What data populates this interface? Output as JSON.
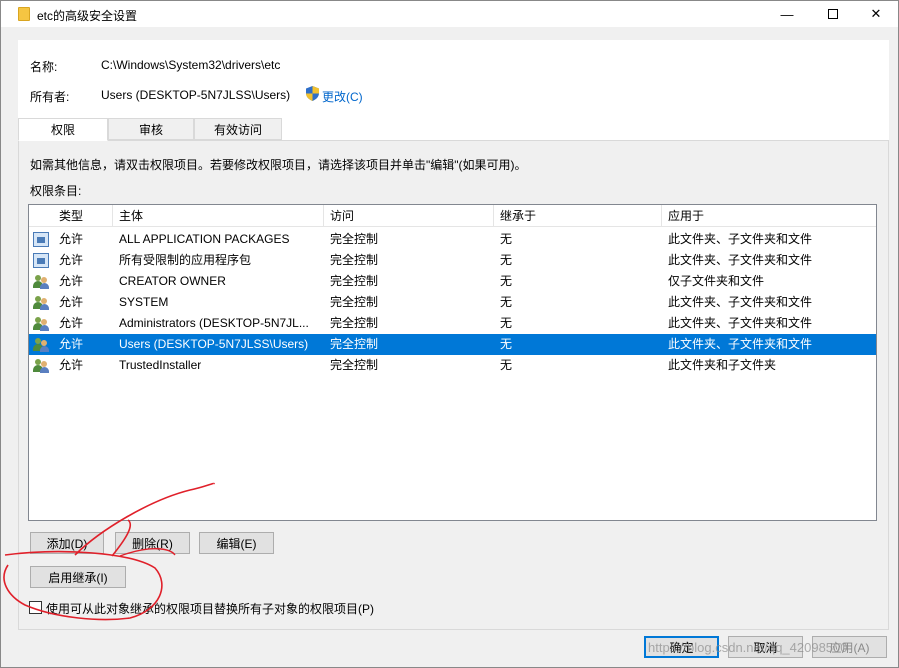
{
  "window": {
    "title": "etc的高级安全设置",
    "min_icon": "minimize-icon",
    "max_icon": "maximize-icon",
    "close_icon": "close-icon"
  },
  "header": {
    "name_label": "名称:",
    "name_value": "C:\\Windows\\System32\\drivers\\etc",
    "owner_label": "所有者:",
    "owner_value": "Users (DESKTOP-5N7JLSS\\Users)",
    "change_link": "更改(C)",
    "shield_icon": "uac-shield-icon"
  },
  "tabs": [
    {
      "label": "权限",
      "active": true
    },
    {
      "label": "审核",
      "active": false
    },
    {
      "label": "有效访问",
      "active": false
    }
  ],
  "info_text": "如需其他信息，请双击权限项目。若要修改权限项目，请选择该项目并单击\"编辑\"(如果可用)。",
  "entries_label": "权限条目:",
  "table": {
    "columns": [
      "类型",
      "主体",
      "访问",
      "继承于",
      "应用于"
    ],
    "rows": [
      {
        "icon": "app-package-icon",
        "type": "允许",
        "principal": "ALL APPLICATION PACKAGES",
        "access": "完全控制",
        "inherited": "无",
        "applies": "此文件夹、子文件夹和文件",
        "selected": false
      },
      {
        "icon": "app-package-icon",
        "type": "允许",
        "principal": "所有受限制的应用程序包",
        "access": "完全控制",
        "inherited": "无",
        "applies": "此文件夹、子文件夹和文件",
        "selected": false
      },
      {
        "icon": "users-icon",
        "type": "允许",
        "principal": "CREATOR OWNER",
        "access": "完全控制",
        "inherited": "无",
        "applies": "仅子文件夹和文件",
        "selected": false
      },
      {
        "icon": "users-icon",
        "type": "允许",
        "principal": "SYSTEM",
        "access": "完全控制",
        "inherited": "无",
        "applies": "此文件夹、子文件夹和文件",
        "selected": false
      },
      {
        "icon": "users-icon",
        "type": "允许",
        "principal": "Administrators (DESKTOP-5N7JL...",
        "access": "完全控制",
        "inherited": "无",
        "applies": "此文件夹、子文件夹和文件",
        "selected": false
      },
      {
        "icon": "users-icon",
        "type": "允许",
        "principal": "Users (DESKTOP-5N7JLSS\\Users)",
        "access": "完全控制",
        "inherited": "无",
        "applies": "此文件夹、子文件夹和文件",
        "selected": true
      },
      {
        "icon": "users-icon",
        "type": "允许",
        "principal": "TrustedInstaller",
        "access": "完全控制",
        "inherited": "无",
        "applies": "此文件夹和子文件夹",
        "selected": false
      }
    ]
  },
  "buttons": {
    "add": "添加(D)",
    "remove": "删除(R)",
    "edit": "编辑(E)",
    "enable_inheritance": "启用继承(I)",
    "ok": "确定",
    "cancel": "取消",
    "apply": "应用(A)"
  },
  "replace_checkbox": {
    "label": "使用可从此对象继承的权限项目替换所有子对象的权限项目(P)",
    "checked": false
  },
  "watermark": "https://blog.csdn.net/qq_42098500",
  "colors": {
    "selection": "#0078d7",
    "annotation": "#e0202a",
    "link": "#0066cc"
  }
}
